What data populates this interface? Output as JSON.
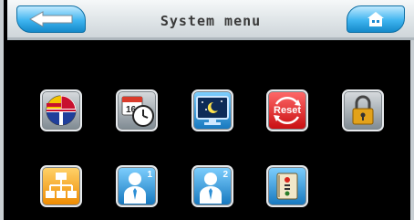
{
  "header": {
    "title": "System menu"
  },
  "menu": {
    "reset_label": "Reset",
    "user1_number": "1",
    "user2_number": "2",
    "calendar_day": "16"
  },
  "icons": {
    "back": "back-arrow-icon",
    "home": "home-icon",
    "items": [
      "language-flags-icon",
      "date-time-icon",
      "screen-icon",
      "reset-icon",
      "lock-icon",
      "network-icon",
      "user-1-icon",
      "user-2-icon",
      "info-icon"
    ]
  },
  "colors": {
    "header_button": "#2aa7e6",
    "reset": "#d81818",
    "network": "#f2a114"
  }
}
